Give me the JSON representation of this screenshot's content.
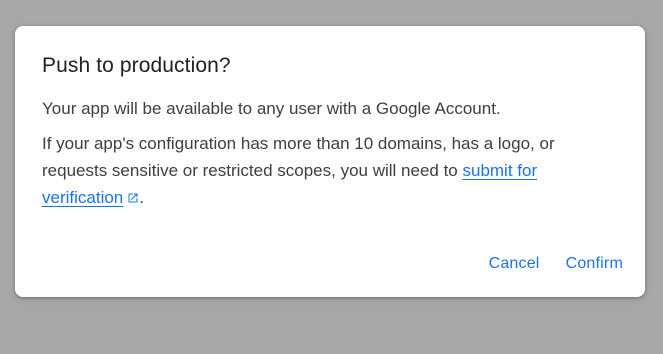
{
  "dialog": {
    "title": "Push to production?",
    "paragraph1": "Your app will be available to any user with a Google Account.",
    "paragraph2_before": "If your app's configuration has more than 10 domains, has a logo, or requests sensitive or restricted scopes, you will need to ",
    "link_text": "submit for verification",
    "paragraph2_after": ".",
    "link_icon": "external-link-icon",
    "cancel_label": "Cancel",
    "confirm_label": "Confirm"
  },
  "colors": {
    "backdrop": "#a8a8a8",
    "accent": "#1a73e8",
    "text": "#3c4043",
    "title": "#202124"
  }
}
